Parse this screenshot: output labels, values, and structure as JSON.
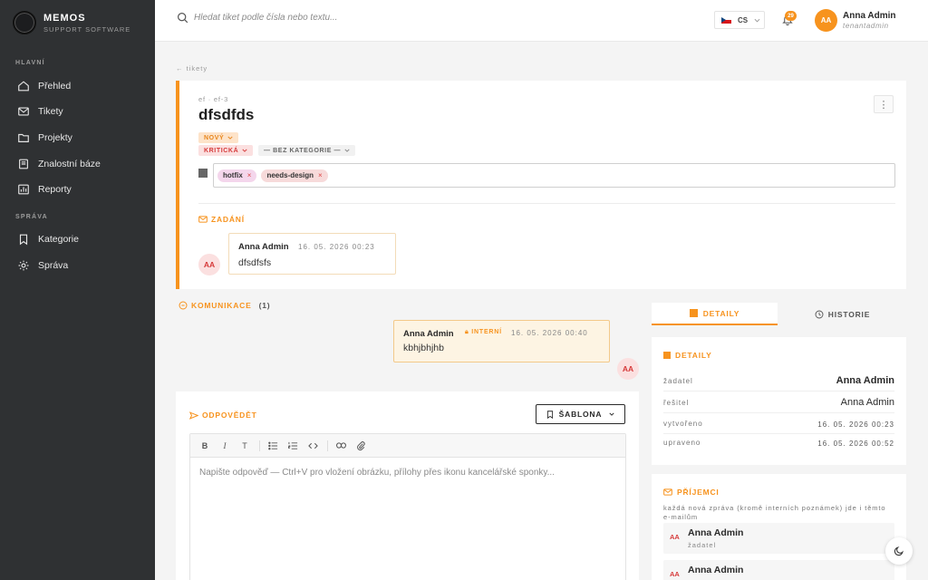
{
  "brand": {
    "name": "MEMOS",
    "subtitle": "SUPPORT SOFTWARE"
  },
  "sidebar": {
    "sections": [
      {
        "label": "HLAVNÍ"
      },
      {
        "label": "SPRÁVA"
      }
    ],
    "items": [
      {
        "label": "Přehled",
        "icon": "home-icon"
      },
      {
        "label": "Tikety",
        "icon": "mail-icon"
      },
      {
        "label": "Projekty",
        "icon": "folder-icon"
      },
      {
        "label": "Znalostní báze",
        "icon": "book-icon"
      },
      {
        "label": "Reporty",
        "icon": "chart-icon"
      },
      {
        "label": "Kategorie",
        "icon": "bookmark-icon"
      },
      {
        "label": "Správa",
        "icon": "gear-icon"
      }
    ]
  },
  "topbar": {
    "search_placeholder": "Hledat tiket podle čísla nebo textu...",
    "language": "CS",
    "notifications_count": "29",
    "user": {
      "initials": "AA",
      "name": "Anna Admin",
      "role": "tenantadmin"
    }
  },
  "breadcrumb": "← tikety",
  "ticket": {
    "ref": "ef · ef-3",
    "title": "dfsdfds",
    "status": "NOVÝ",
    "priority": "KRITICKÁ",
    "category": "— BEZ KATEGORIE —",
    "tags": [
      "hotfix",
      "needs-design"
    ],
    "assignment_label": "ZADÁNÍ",
    "assignment": {
      "author": "Anna Admin",
      "time": "16. 05. 2026 00:23",
      "text": "dfsdfsfs",
      "initials": "AA"
    }
  },
  "communication": {
    "label": "KOMUNIKACE",
    "count": "(1)",
    "messages": [
      {
        "author": "Anna Admin",
        "internal_label": "INTERNÍ",
        "time": "16. 05. 2026 00:40",
        "text": "kbhjbhjhb",
        "initials": "AA"
      }
    ]
  },
  "reply": {
    "label": "ODPOVĚDĚT",
    "template_button": "ŠABLONA",
    "placeholder": "Napište odpověď — Ctrl+V pro vložení obrázku, přílohy přes ikonu kancelářské sponky..."
  },
  "tabs": {
    "details": "DETAILY",
    "history": "HISTORIE"
  },
  "details": {
    "title": "DETAILY",
    "rows": [
      {
        "key": "žadatel",
        "value": "Anna Admin"
      },
      {
        "key": "řešitel",
        "value": "Anna Admin"
      },
      {
        "key": "vytvořeno",
        "value": "16. 05. 2026 00:23"
      },
      {
        "key": "upraveno",
        "value": "16. 05. 2026 00:52"
      }
    ]
  },
  "recipients": {
    "title": "PŘÍJEMCI",
    "description": "každá nová zpráva (kromě interních poznámek) jde i těmto e-mailům",
    "items": [
      {
        "initials": "AA",
        "name": "Anna Admin",
        "role": "žadatel"
      },
      {
        "initials": "AA",
        "name": "Anna Admin",
        "role": ""
      }
    ]
  },
  "colors": {
    "accent": "#f7931e",
    "sidebar": "#2f3133",
    "danger": "#d63a3a"
  }
}
